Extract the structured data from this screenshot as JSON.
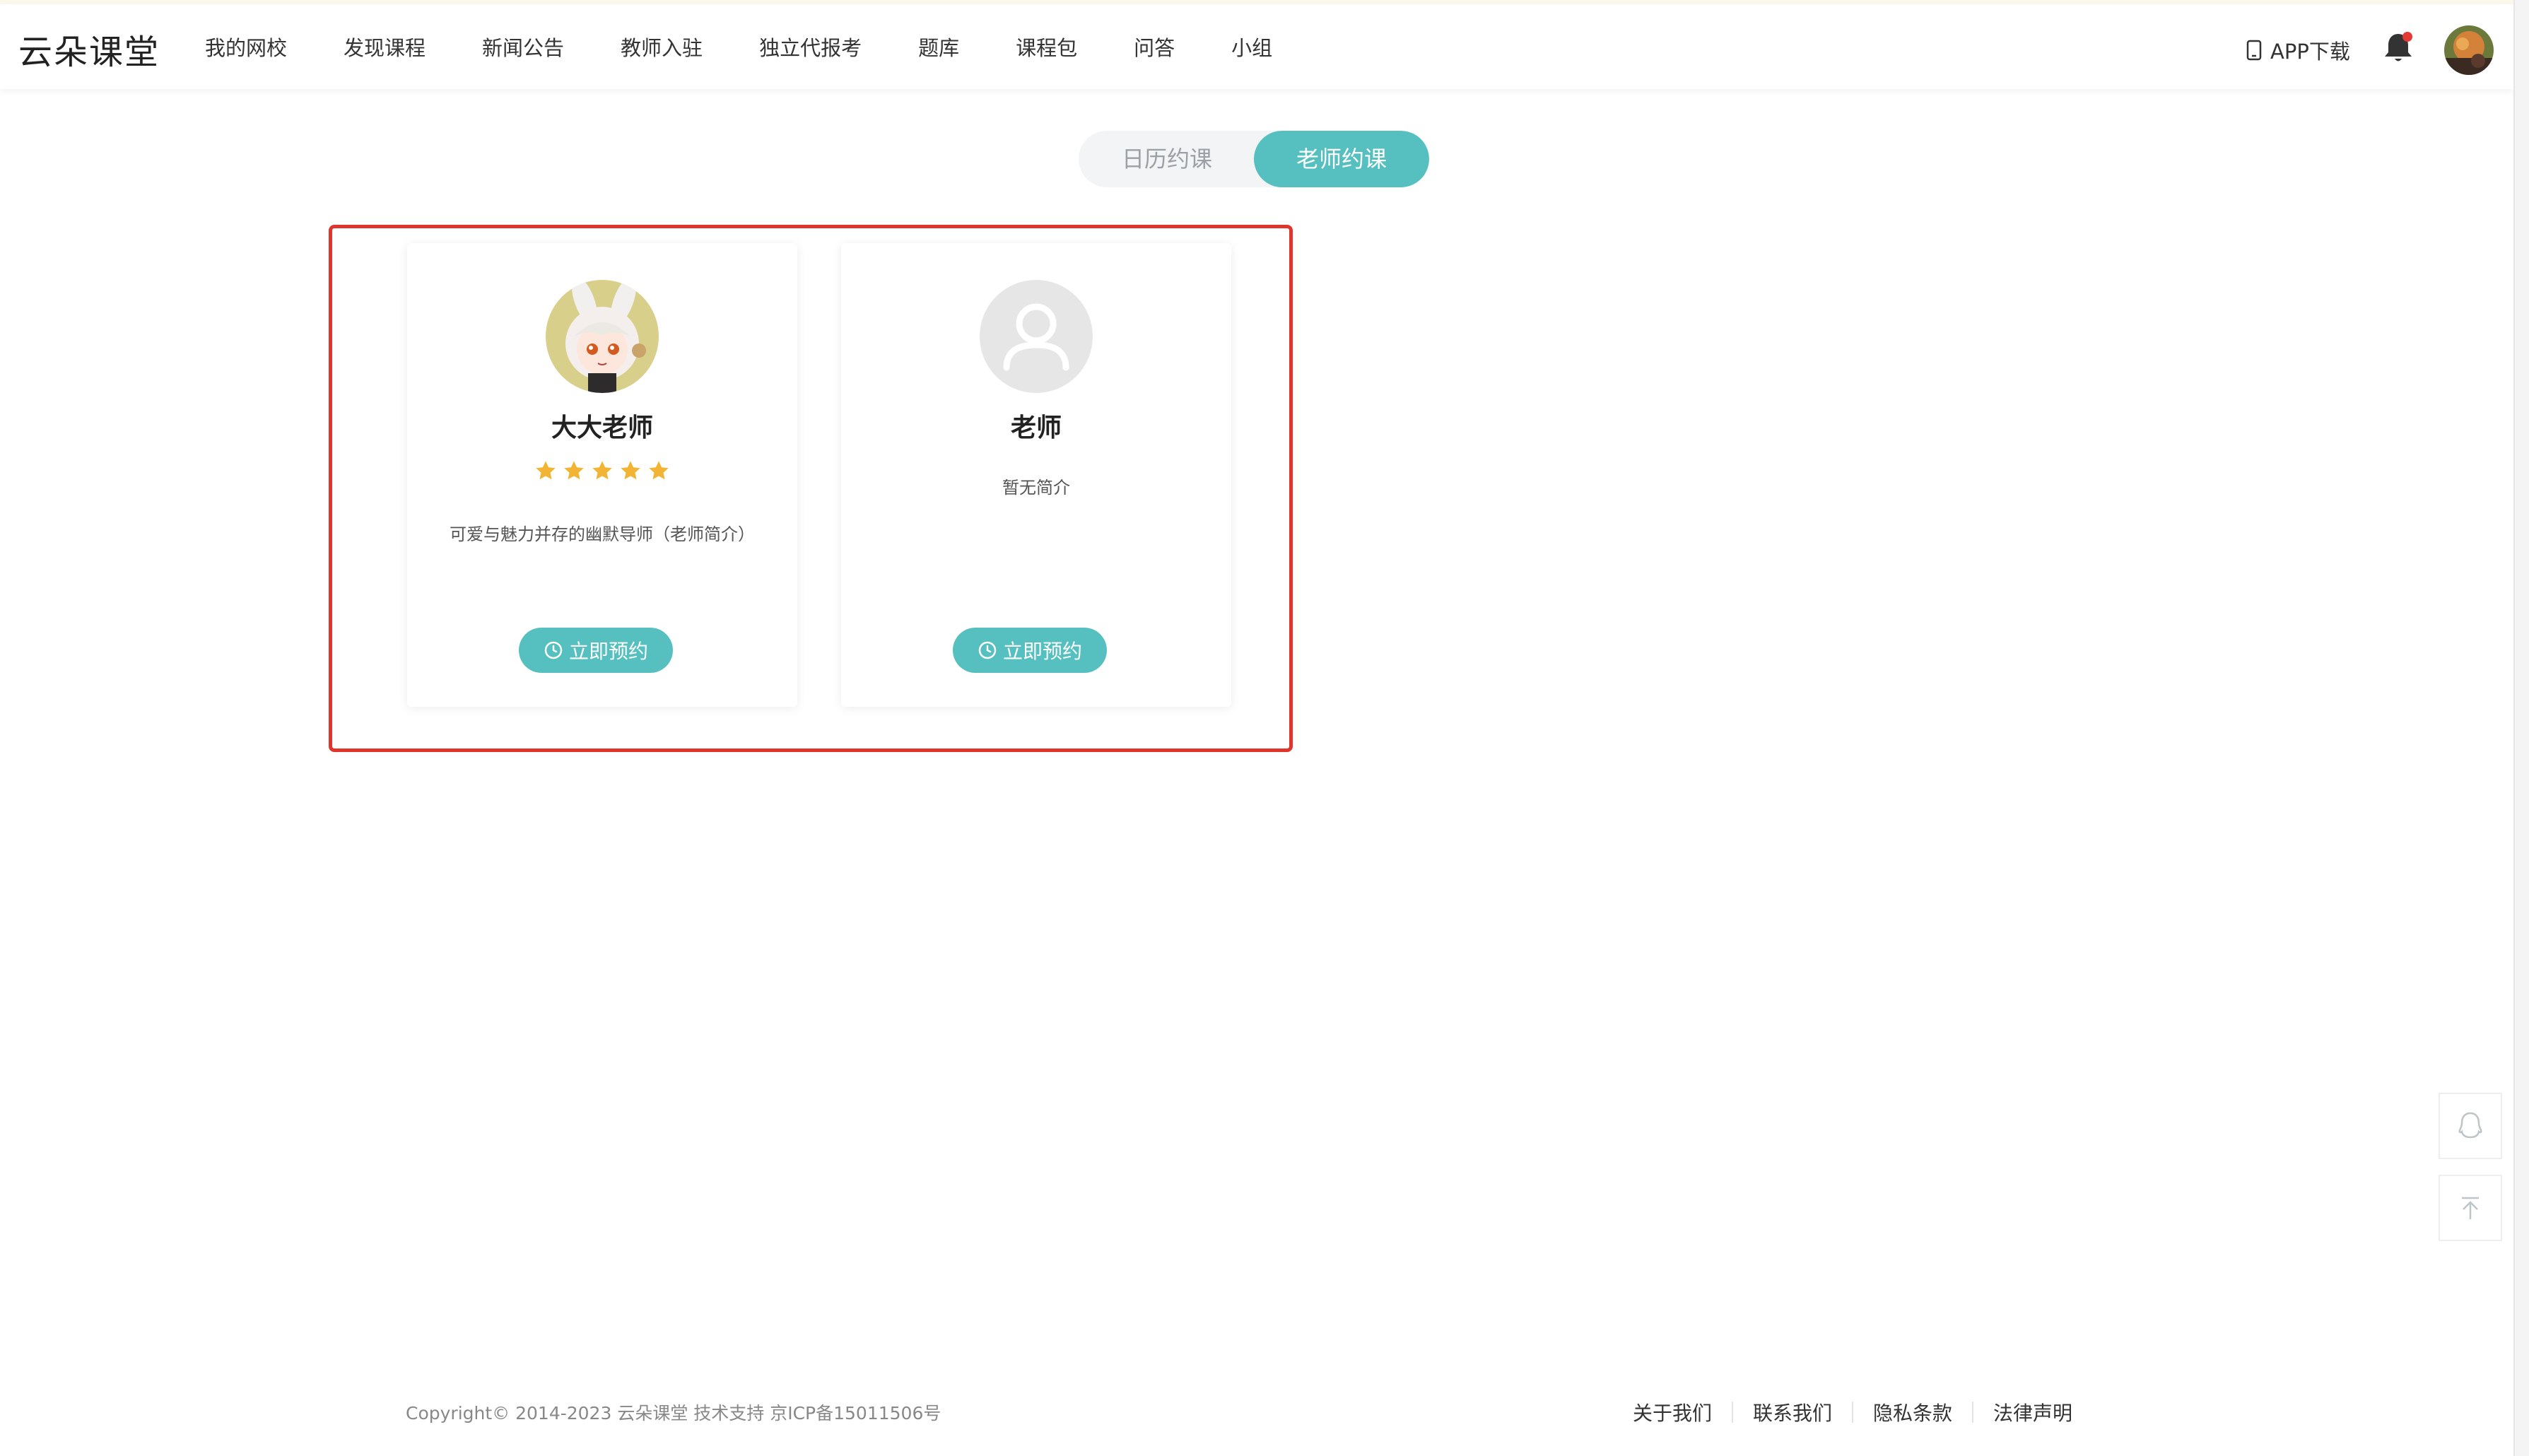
{
  "header": {
    "logo": "云朵课堂",
    "nav": [
      "我的网校",
      "发现课程",
      "新闻公告",
      "教师入驻",
      "独立代报考",
      "题库",
      "课程包",
      "问答",
      "小组"
    ],
    "app_download": "APP下载",
    "icons": {
      "phone": "phone-icon",
      "bell": "bell-icon",
      "avatar": "user-avatar"
    }
  },
  "tabs": {
    "calendar": "日历约课",
    "teacher": "老师约课",
    "active": "老师约课"
  },
  "teachers": [
    {
      "name": "大大老师",
      "rating": 5,
      "intro": "可爱与魅力并存的幽默导师（老师简介）",
      "button": "立即预约"
    },
    {
      "name": "老师",
      "rating": null,
      "intro": "暂无简介",
      "button": "立即预约"
    }
  ],
  "side_tools": {
    "qq": "qq-icon",
    "back_to_top": "arrow-up-icon"
  },
  "footer": {
    "copyright": "Copyright© 2014-2023  云朵课堂 技术支持 京ICP备15011506号",
    "links": [
      "关于我们",
      "联系我们",
      "隐私条款",
      "法律声明"
    ]
  },
  "colors": {
    "accent": "#56c0c0",
    "highlight_border": "#e0352b",
    "star": "#f2b533",
    "notification_dot": "#e53935"
  }
}
